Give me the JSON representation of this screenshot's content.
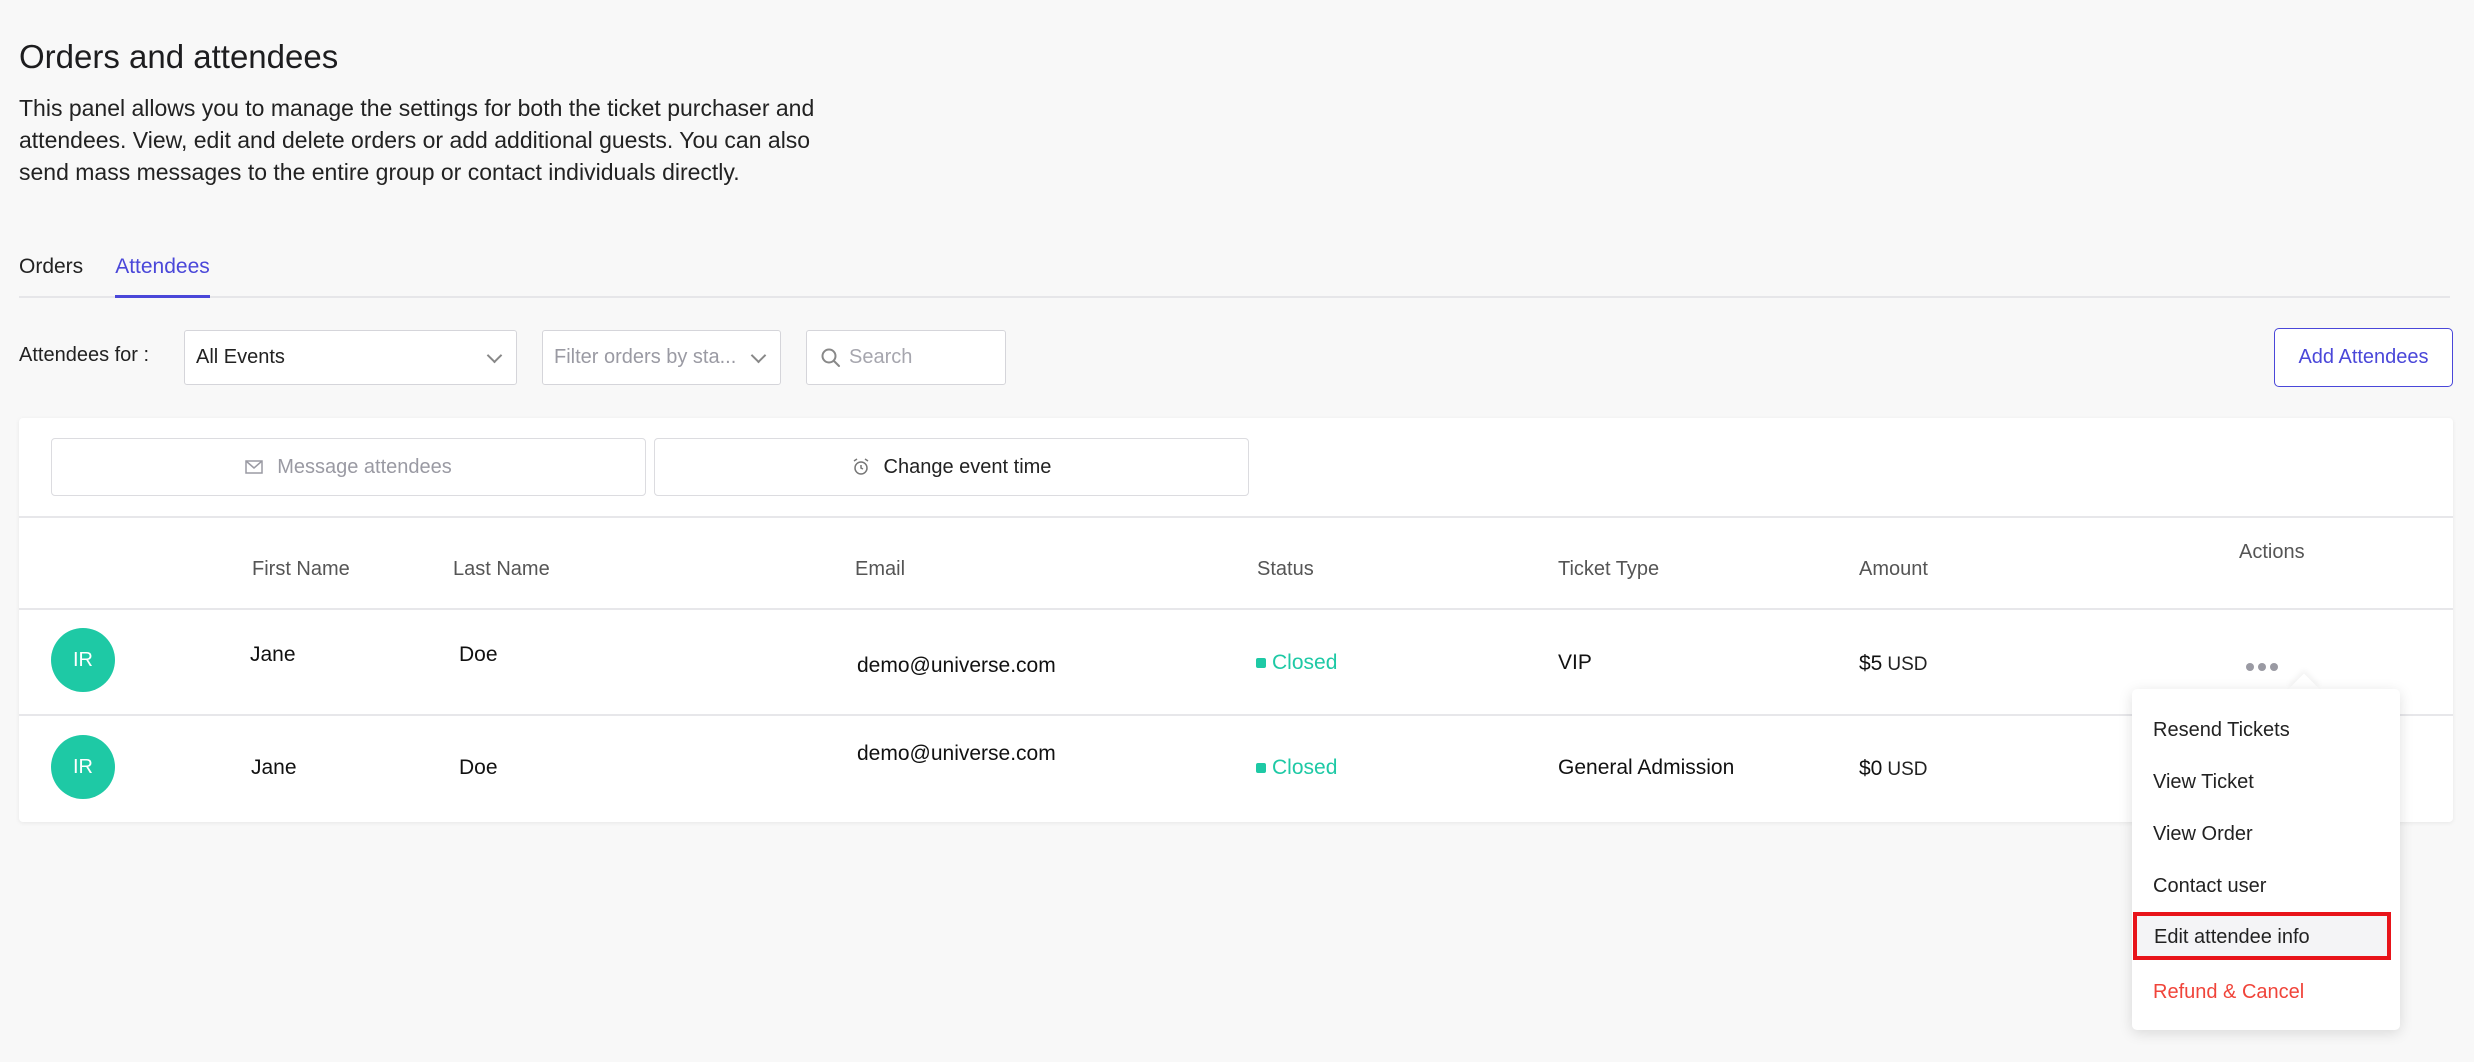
{
  "page": {
    "title": "Orders and attendees",
    "description": "This panel allows you to manage the settings for both the ticket purchaser and attendees. View, edit and delete orders or add additional guests. You can also send mass messages to the entire group or contact individuals directly."
  },
  "tabs": [
    {
      "label": "Orders",
      "active": false
    },
    {
      "label": "Attendees",
      "active": true
    }
  ],
  "filters": {
    "label": "Attendees for :",
    "events_value": "All Events",
    "status_placeholder": "Filter orders by sta...",
    "search_placeholder": "Search"
  },
  "add_button": "Add Attendees",
  "actions": {
    "message": "Message attendees",
    "change_time": "Change event time"
  },
  "table": {
    "headers": [
      "First Name",
      "Last Name",
      "Email",
      "Status",
      "Ticket Type",
      "Amount",
      "Actions"
    ],
    "rows": [
      {
        "initials": "IR",
        "first": "Jane",
        "last": "Doe",
        "email": "demo@universe.com",
        "status": "Closed",
        "ticket": "VIP",
        "amount": "$5",
        "currency": "USD"
      },
      {
        "initials": "IR",
        "first": "Jane",
        "last": "Doe",
        "email": "demo@universe.com",
        "status": "Closed",
        "ticket": "General Admission",
        "amount": "$0",
        "currency": "USD"
      }
    ]
  },
  "menu": {
    "items": [
      "Resend Tickets",
      "View Ticket",
      "View Order",
      "Contact user",
      "Edit attendee info",
      "Refund & Cancel"
    ],
    "highlighted": "Edit attendee info"
  },
  "colors": {
    "accent": "#4a47d9",
    "status_closed": "#1ec9a5",
    "avatar": "#1ec9a5",
    "danger": "#f0443a",
    "highlight_border": "#e8141a"
  },
  "icons": {
    "search": "search-icon",
    "envelope": "envelope-icon",
    "alarm": "alarm-clock-icon",
    "more": "more-dots-icon",
    "chevron": "chevron-down-icon"
  }
}
